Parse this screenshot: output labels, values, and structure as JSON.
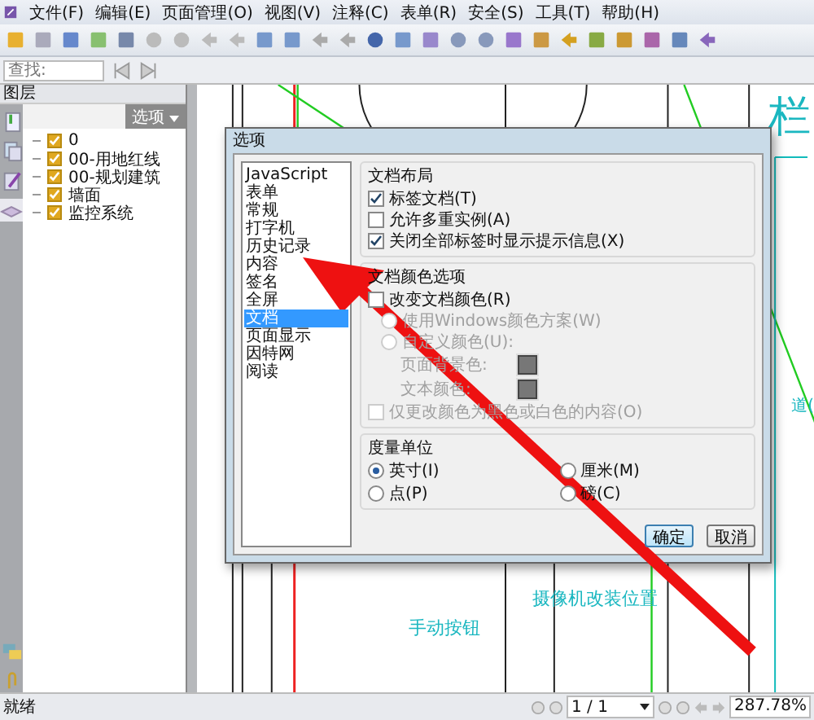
{
  "menu": [
    "文件(F)",
    "编辑(E)",
    "页面管理(O)",
    "视图(V)",
    "注释(C)",
    "表单(R)",
    "安全(S)",
    "工具(T)",
    "帮助(H)"
  ],
  "search": {
    "placeholder": "查找:"
  },
  "sidebar": {
    "title": "图层",
    "options_button": "选项",
    "layers": [
      {
        "name": "0",
        "checked": true
      },
      {
        "name": "00-用地红线",
        "checked": true
      },
      {
        "name": "00-规划建筑",
        "checked": true
      },
      {
        "name": "墙面",
        "checked": true
      },
      {
        "name": "监控系统",
        "checked": true
      }
    ]
  },
  "drawing": {
    "title_fragment": "栏",
    "edge_label": "道(",
    "camera_label": "摄像机改装位置",
    "button_label": "手动按钮"
  },
  "dialog": {
    "title": "选项",
    "categories": [
      {
        "label": "JavaScript",
        "selected": false
      },
      {
        "label": "表单",
        "selected": false
      },
      {
        "label": "常规",
        "selected": false
      },
      {
        "label": "打字机",
        "selected": false
      },
      {
        "label": "历史记录",
        "selected": false
      },
      {
        "label": "内容",
        "selected": false
      },
      {
        "label": "签名",
        "selected": false
      },
      {
        "label": "全屏",
        "selected": false
      },
      {
        "label": "文档",
        "selected": true
      },
      {
        "label": "页面显示",
        "selected": false
      },
      {
        "label": "因特网",
        "selected": false
      },
      {
        "label": "阅读",
        "selected": false
      }
    ],
    "layout_group": {
      "title": "文档布局",
      "options": [
        {
          "label": "标签文档(T)",
          "checked": true
        },
        {
          "label": "允许多重实例(A)",
          "checked": false
        },
        {
          "label": "关闭全部标签时显示提示信息(X)",
          "checked": true
        }
      ]
    },
    "color_group": {
      "title": "文档颜色选项",
      "change_color": {
        "label": "改变文档颜色(R)",
        "checked": false
      },
      "items": [
        {
          "kind": "radio",
          "label": "使用Windows颜色方案(W)",
          "selected": false,
          "disabled": true
        },
        {
          "kind": "radio",
          "label": "自定义颜色(U):",
          "selected": false,
          "disabled": true
        },
        {
          "kind": "swatch",
          "label": "页面背景色:",
          "disabled": true
        },
        {
          "kind": "swatch",
          "label": "文本颜色:",
          "disabled": true
        },
        {
          "kind": "checkbox",
          "label": "仅更改颜色为黑色或白色的内容(O)",
          "checked": false,
          "disabled": true
        }
      ]
    },
    "units_group": {
      "title": "度量单位",
      "units": [
        {
          "label": "英寸(I)",
          "selected": true
        },
        {
          "label": "厘米(M)",
          "selected": false
        },
        {
          "label": "点(P)",
          "selected": false
        },
        {
          "label": "磅(C)",
          "selected": false
        }
      ]
    },
    "buttons": [
      {
        "label": "确定",
        "default": true
      },
      {
        "label": "取消",
        "default": false
      }
    ]
  },
  "status_bar": {
    "status": "就绪",
    "page": "1 / 1",
    "zoom": "287.78%"
  }
}
